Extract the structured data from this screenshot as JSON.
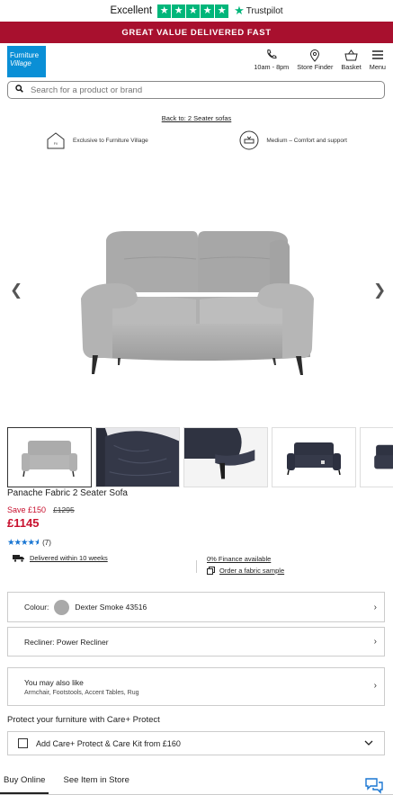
{
  "trustpilot": {
    "excellent": "Excellent",
    "brand": "Trustpilot"
  },
  "promo": {
    "text": "GREAT VALUE DELIVERED FAST"
  },
  "header": {
    "logo_line1": "Furniture",
    "logo_line2": "Village",
    "hours": "10am - 8pm",
    "store_finder": "Store Finder",
    "basket": "Basket",
    "menu": "Menu"
  },
  "search": {
    "placeholder": "Search for a product or brand"
  },
  "breadcrumb": {
    "back": "Back to: 2 Seater sofas"
  },
  "features": {
    "exclusive": "Exclusive to Furniture Village",
    "comfort": "Medium – Comfort and support"
  },
  "product": {
    "name": "Panache Fabric 2 Seater Sofa",
    "save": "Save £150",
    "was": "£1295",
    "price": "£1145",
    "review_count": "(7)",
    "rating": 4.5
  },
  "delivery": {
    "text": "Delivered within 10 weeks",
    "finance": "0% Finance available",
    "sample": "Order a fabric sample"
  },
  "options": {
    "colour_label": "Colour:",
    "colour_value": "Dexter Smoke 43516",
    "recliner": "Recliner: Power Recliner",
    "also_title": "You may also like",
    "also_sub": "Armchair, Footstools, Accent Tables, Rug"
  },
  "protect": {
    "title": "Protect your furniture with Care+ Protect",
    "option": "Add Care+ Protect & Care Kit from £160"
  },
  "tabs": {
    "buy_online": "Buy Online",
    "see_in_store": "See Item in Store"
  },
  "colors": {
    "brand_red": "#a8102e",
    "price_red": "#c8102e",
    "trustpilot_green": "#00b67a",
    "logo_blue": "#0a8fd6",
    "star_blue": "#1976d2"
  }
}
